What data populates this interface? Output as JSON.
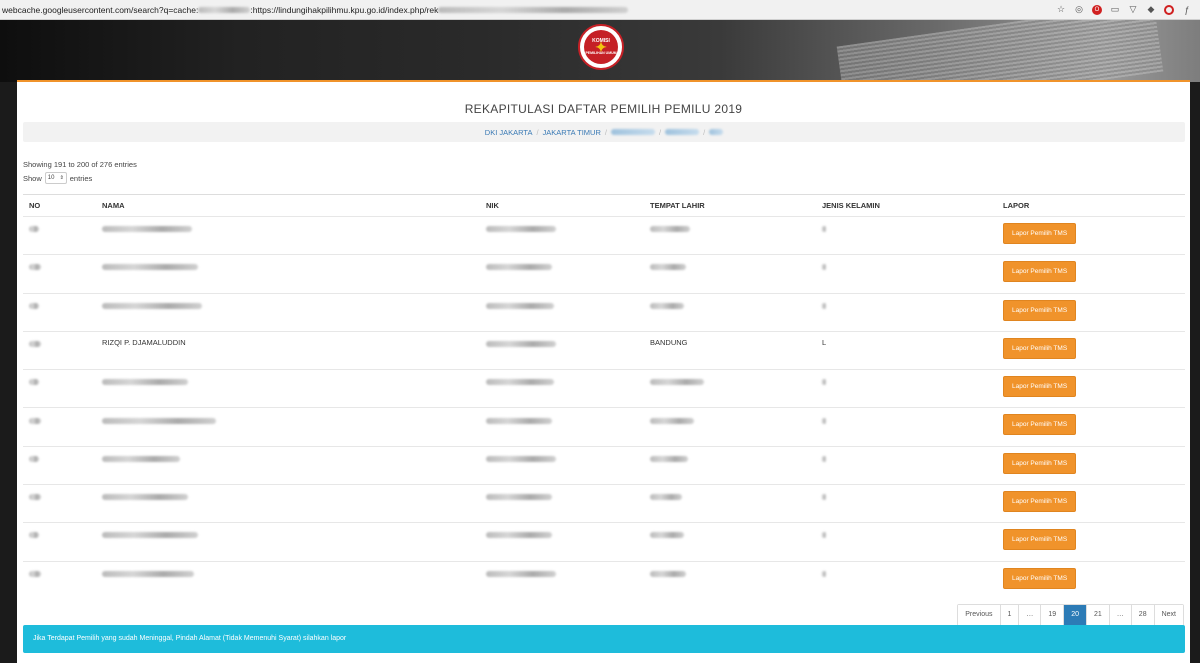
{
  "browser": {
    "url_prefix": "webcache.googleusercontent.com/search?q=cache:",
    "url_middle": ":https://lindungihakpilihmu.kpu.go.id/index.php/rek"
  },
  "header": {
    "logo_text_top": "KOMISI",
    "logo_text_bottom": "PEMILIHAN UMUM"
  },
  "page": {
    "title": "REKAPITULASI DAFTAR PEMILIH PEMILU 2019",
    "breadcrumb": [
      "DKI JAKARTA",
      "JAKARTA TIMUR"
    ],
    "showing": "Showing 191 to 200 of 276 entries",
    "show_label": "Show",
    "show_value": "10",
    "entries_label": "entries"
  },
  "table": {
    "headers": [
      "NO",
      "NAMA",
      "NIK",
      "TEMPAT LAHIR",
      "JENIS KELAMIN",
      "LAPOR"
    ],
    "rows": [
      {
        "no": "",
        "nama": "",
        "nik": "",
        "tempat": "",
        "jk": "",
        "button": "Lapor Pemilih TMS"
      },
      {
        "no": "",
        "nama": "",
        "nik": "",
        "tempat": "",
        "jk": "",
        "button": "Lapor Pemilih TMS"
      },
      {
        "no": "",
        "nama": "",
        "nik": "",
        "tempat": "",
        "jk": "",
        "button": "Lapor Pemilih TMS"
      },
      {
        "no": "",
        "nama": "RIZQI P. DJAMALUDDIN",
        "nik": "",
        "tempat": "BANDUNG",
        "jk": "L",
        "button": "Lapor Pemilih TMS"
      },
      {
        "no": "",
        "nama": "",
        "nik": "",
        "tempat": "",
        "jk": "",
        "button": "Lapor Pemilih TMS"
      },
      {
        "no": "",
        "nama": "",
        "nik": "",
        "tempat": "",
        "jk": "",
        "button": "Lapor Pemilih TMS"
      },
      {
        "no": "",
        "nama": "",
        "nik": "",
        "tempat": "",
        "jk": "",
        "button": "Lapor Pemilih TMS"
      },
      {
        "no": "",
        "nama": "",
        "nik": "",
        "tempat": "",
        "jk": "",
        "button": "Lapor Pemilih TMS"
      },
      {
        "no": "",
        "nama": "",
        "nik": "",
        "tempat": "",
        "jk": "",
        "button": "Lapor Pemilih TMS"
      },
      {
        "no": "",
        "nama": "",
        "nik": "",
        "tempat": "",
        "jk": "",
        "button": "Lapor Pemilih TMS"
      }
    ]
  },
  "pagination": {
    "items": [
      "Previous",
      "1",
      "…",
      "19",
      "20",
      "21",
      "…",
      "28",
      "Next"
    ],
    "active": "20"
  },
  "info": "Jika Terdapat Pemilih yang sudah Meninggal, Pindah Alamat (Tidak Memenuhi Syarat) silahkan lapor",
  "colors": {
    "accent": "#f0932b",
    "info": "#1ebcdb",
    "active_page": "#2c7bb6",
    "link": "#3a7ab5"
  }
}
